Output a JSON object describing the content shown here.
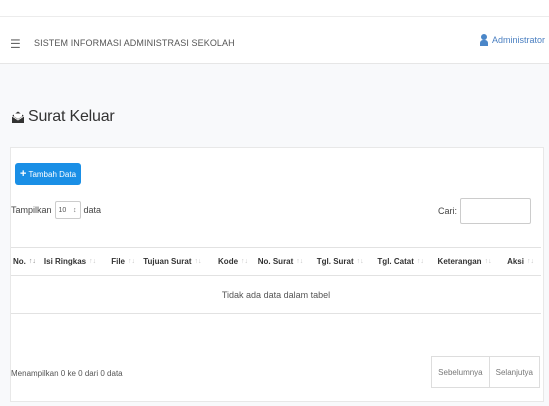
{
  "navbar": {
    "title": "SISTEM INFORMASI ADMINISTRASI SEKOLAH",
    "user": "Administrator"
  },
  "page": {
    "title": "Surat Keluar"
  },
  "toolbar": {
    "add_label": "Tambah Data"
  },
  "length": {
    "prefix": "Tampilkan",
    "value": "10",
    "suffix": "data"
  },
  "search": {
    "label": "Cari:"
  },
  "table": {
    "columns": [
      {
        "label": "No."
      },
      {
        "label": "Isi Ringkas"
      },
      {
        "label": "File"
      },
      {
        "label": "Tujuan Surat"
      },
      {
        "label": "Kode"
      },
      {
        "label": "No. Surat"
      },
      {
        "label": "Tgl. Surat"
      },
      {
        "label": "Tgl. Catat"
      },
      {
        "label": "Keterangan"
      },
      {
        "label": "Aksi"
      }
    ],
    "empty": "Tidak ada data dalam tabel"
  },
  "info": "Menampilkan 0 ke 0 dari 0 data",
  "pager": {
    "prev": "Sebelumnya",
    "next": "Selanjutya"
  },
  "colors": {
    "primary": "#1a8fe6",
    "user_link": "#4a7fc1"
  }
}
